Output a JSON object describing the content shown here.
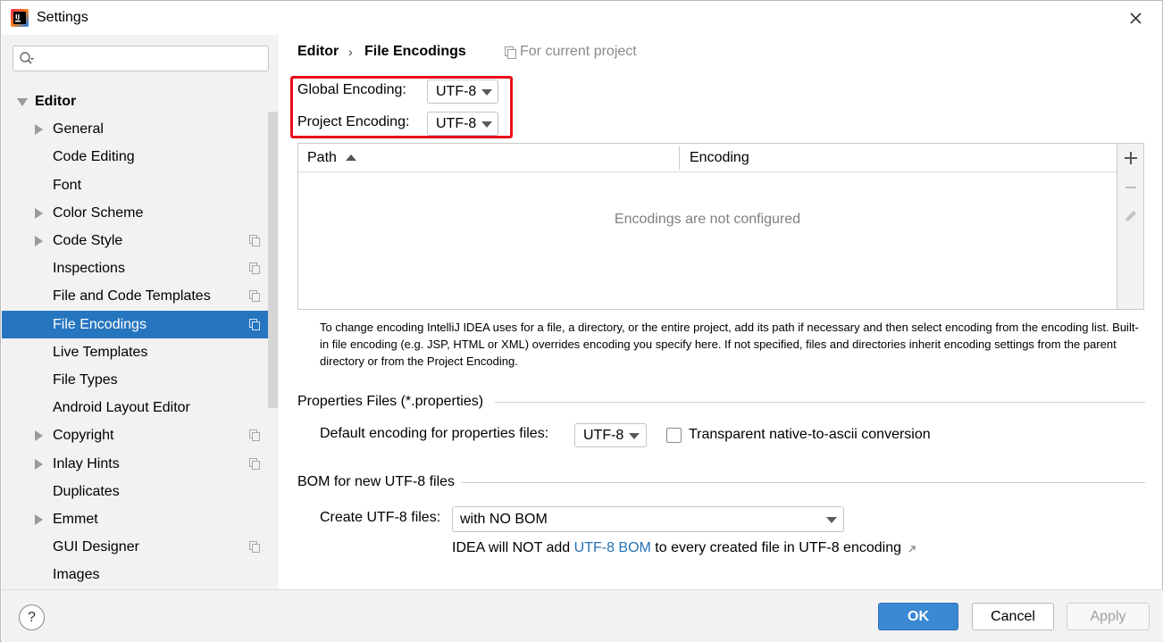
{
  "window": {
    "title": "Settings"
  },
  "sidebar": {
    "search_placeholder": "",
    "items": [
      {
        "label": "Editor",
        "level": 0,
        "arrow": "down",
        "bold": true,
        "scope_icon": false,
        "selected": false
      },
      {
        "label": "General",
        "level": 1,
        "arrow": "right",
        "scope_icon": false,
        "selected": false
      },
      {
        "label": "Code Editing",
        "level": 1,
        "arrow": "",
        "scope_icon": false,
        "selected": false
      },
      {
        "label": "Font",
        "level": 1,
        "arrow": "",
        "scope_icon": false,
        "selected": false
      },
      {
        "label": "Color Scheme",
        "level": 1,
        "arrow": "right",
        "scope_icon": false,
        "selected": false
      },
      {
        "label": "Code Style",
        "level": 1,
        "arrow": "right",
        "scope_icon": true,
        "selected": false
      },
      {
        "label": "Inspections",
        "level": 1,
        "arrow": "",
        "scope_icon": true,
        "selected": false
      },
      {
        "label": "File and Code Templates",
        "level": 1,
        "arrow": "",
        "scope_icon": true,
        "selected": false
      },
      {
        "label": "File Encodings",
        "level": 1,
        "arrow": "",
        "scope_icon": true,
        "selected": true
      },
      {
        "label": "Live Templates",
        "level": 1,
        "arrow": "",
        "scope_icon": false,
        "selected": false
      },
      {
        "label": "File Types",
        "level": 1,
        "arrow": "",
        "scope_icon": false,
        "selected": false
      },
      {
        "label": "Android Layout Editor",
        "level": 1,
        "arrow": "",
        "scope_icon": false,
        "selected": false
      },
      {
        "label": "Copyright",
        "level": 1,
        "arrow": "right",
        "scope_icon": true,
        "selected": false
      },
      {
        "label": "Inlay Hints",
        "level": 1,
        "arrow": "right",
        "scope_icon": true,
        "selected": false
      },
      {
        "label": "Duplicates",
        "level": 1,
        "arrow": "",
        "scope_icon": false,
        "selected": false
      },
      {
        "label": "Emmet",
        "level": 1,
        "arrow": "right",
        "scope_icon": false,
        "selected": false
      },
      {
        "label": "GUI Designer",
        "level": 1,
        "arrow": "",
        "scope_icon": true,
        "selected": false
      },
      {
        "label": "Images",
        "level": 1,
        "arrow": "",
        "scope_icon": false,
        "selected": false
      }
    ]
  },
  "breadcrumb": {
    "parent": "Editor",
    "separator": "›",
    "page": "File Encodings",
    "scope": "For current project"
  },
  "encodings": {
    "global_label": "Global Encoding:",
    "global_value": "UTF-8",
    "project_label": "Project Encoding:",
    "project_value": "UTF-8"
  },
  "table": {
    "col_path": "Path",
    "col_encoding": "Encoding",
    "empty_text": "Encodings are not configured"
  },
  "help_text": "To change encoding IntelliJ IDEA uses for a file, a directory, or the entire project, add its path if necessary and then select encoding from the encoding list. Built-in file encoding (e.g. JSP, HTML or XML) overrides encoding you specify here. If not specified, files and directories inherit encoding settings from the parent directory or from the Project Encoding.",
  "properties": {
    "section_title": "Properties Files (*.properties)",
    "default_label": "Default encoding for properties files:",
    "default_value": "UTF-8",
    "transparent_label": "Transparent native-to-ascii conversion",
    "transparent_checked": false
  },
  "bom": {
    "section_title": "BOM for new UTF-8 files",
    "create_label": "Create UTF-8 files:",
    "create_value": "with NO BOM",
    "note_prefix": "IDEA will NOT add ",
    "note_link": "UTF-8 BOM",
    "note_suffix": " to every created file in UTF-8 encoding"
  },
  "footer": {
    "help": "?",
    "ok": "OK",
    "cancel": "Cancel",
    "apply": "Apply"
  },
  "colors": {
    "selection": "#2675bf",
    "accent": "#3b88d3",
    "highlight_box": "#e8101a",
    "link": "#2470b3"
  }
}
